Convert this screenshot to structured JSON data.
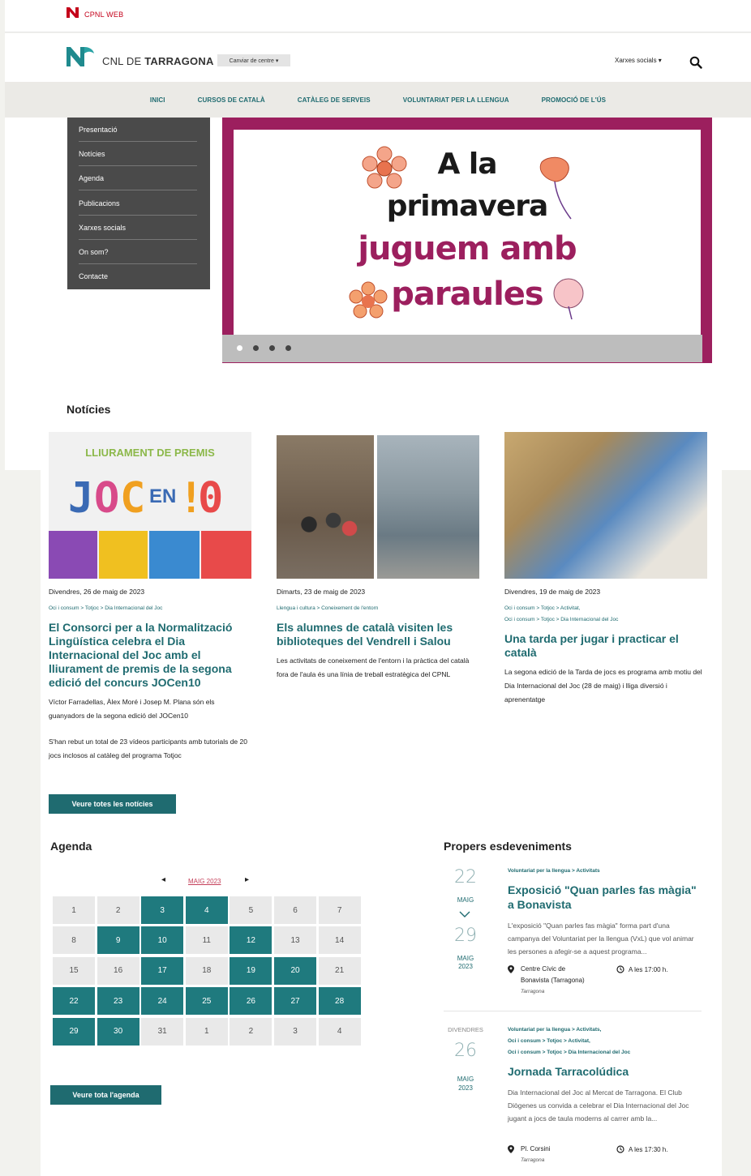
{
  "topbar": {
    "brand": "CPNL WEB"
  },
  "header": {
    "title_light": "CNL DE ",
    "title_bold": "TARRAGONA",
    "centre_button": "Canviar de centre ▾",
    "social": "Xarxes socials ▾"
  },
  "nav": [
    "INICI",
    "CURSOS DE CATALÀ",
    "CATÀLEG DE SERVEIS",
    "VOLUNTARIAT PER LA LLENGUA",
    "PROMOCIÓ DE L'ÚS"
  ],
  "sidemenu": [
    "Presentació",
    "Notícies",
    "Agenda",
    "Publicacions",
    "Xarxes socials",
    "On som?",
    "Contacte"
  ],
  "banner": {
    "line1": "A la",
    "line2": "primavera",
    "line3": "juguem amb",
    "line4": "paraules",
    "colors": {
      "frame": "#9c1f5e",
      "accent": "#9c1f5e",
      "text": "#1a1a1a"
    }
  },
  "news": {
    "heading": "Notícies",
    "items": [
      {
        "img_text": "LLIURAMENT DE PREMIS",
        "date": "Divendres, 26 de maig de 2023",
        "tags": [
          "Oci i consum > Totjoc > Dia Internacional del Joc"
        ],
        "title": "El Consorci per a la Normalització Lingüística celebra el Dia Internacional del Joc amb el lliurament de premis de la segona edició del concurs JOCen10",
        "body1": "Víctor Farradellas, Àlex Moré i Josep M. Plana són els guanyadors de la segona edició del JOCen10",
        "body2": "S'han rebut un total de 23 vídeos participants amb tutorials de 20 jocs inclosos al catàleg del programa Totjoc"
      },
      {
        "date": "Dimarts, 23 de maig de 2023",
        "tags": [
          "Llengua i cultura > Coneixement de l'entorn"
        ],
        "title": "Els alumnes de català visiten les biblioteques del Vendrell i Salou",
        "body1": "Les activitats de coneixement de l'entorn i la pràctica del català fora de l'aula és una línia de treball estratègica del CPNL"
      },
      {
        "date": "Divendres, 19 de maig de 2023",
        "tags": [
          "Oci i consum > Totjoc > Activitat,",
          "Oci i consum > Totjoc > Dia Internacional del Joc"
        ],
        "title": "Una tarda per jugar i practicar el català",
        "body1": "La segona edició de la Tarda de jocs es programa amb motiu del Dia Internacional del Joc (28 de maig) i lliga diversió i aprenentatge"
      }
    ],
    "all_button": "Veure totes les notícies"
  },
  "agenda": {
    "heading": "Agenda",
    "month": "MAIG 2023",
    "prev": "◂",
    "next": "▸",
    "days": [
      [
        "1",
        "2",
        "3",
        "4",
        "5",
        "6",
        "7"
      ],
      [
        "8",
        "9",
        "10",
        "11",
        "12",
        "13",
        "14"
      ],
      [
        "15",
        "16",
        "17",
        "18",
        "19",
        "20",
        "21"
      ],
      [
        "22",
        "23",
        "24",
        "25",
        "26",
        "27",
        "28"
      ],
      [
        "29",
        "30",
        "31",
        "1",
        "2",
        "3",
        "4"
      ]
    ],
    "active_days": [
      [
        false,
        false,
        true,
        true,
        false,
        false,
        false
      ],
      [
        false,
        true,
        true,
        false,
        true,
        false,
        false
      ],
      [
        false,
        false,
        true,
        false,
        true,
        true,
        false
      ],
      [
        true,
        true,
        true,
        true,
        true,
        true,
        true
      ],
      [
        true,
        true,
        false,
        false,
        false,
        false,
        false
      ]
    ],
    "all_button": "Veure tota l'agenda"
  },
  "events": {
    "heading": "Propers esdeveniments",
    "items": [
      {
        "start_day": "22",
        "start_month": "MAIG",
        "end_day": "29",
        "end_month": "MAIG",
        "end_year": "2023",
        "tags": [
          "Voluntariat per la llengua > Activitats"
        ],
        "title": "Exposició \"Quan parles fas màgia\" a Bonavista",
        "body": "L'exposició \"Quan parles fas màgia\" forma part d'una campanya del Voluntariat per la llengua (VxL) que vol animar les persones a afegir-se a aquest programa...",
        "place1": "Centre Cívic de",
        "place2": "Bonavista (Tarragona)",
        "city": "Tarragona",
        "time": "A les 17:00 h."
      },
      {
        "weekday": "DIVENDRES",
        "day": "26",
        "month": "MAIG",
        "year": "2023",
        "tags": [
          "Voluntariat per la llengua > Activitats,",
          "Oci i consum > Totjoc > Activitat,",
          "Oci i consum > Totjoc > Dia Internacional del Joc"
        ],
        "title": "Jornada Tarracolúdica",
        "body": "Dia Internacional del Joc al Mercat de Tarragona. El Club Diògenes us convida a celebrar el Dia Internacional del Joc jugant a jocs de taula moderns al carrer amb la...",
        "place1": "Pl. Corsini",
        "city": "Tarragona",
        "time": "A les 17:30 h."
      }
    ]
  },
  "colors": {
    "brand_red": "#c4001a",
    "teal": "#1f6b70",
    "calendar_on": "#1f7a7e",
    "menu_bg": "#4a4a4a"
  }
}
